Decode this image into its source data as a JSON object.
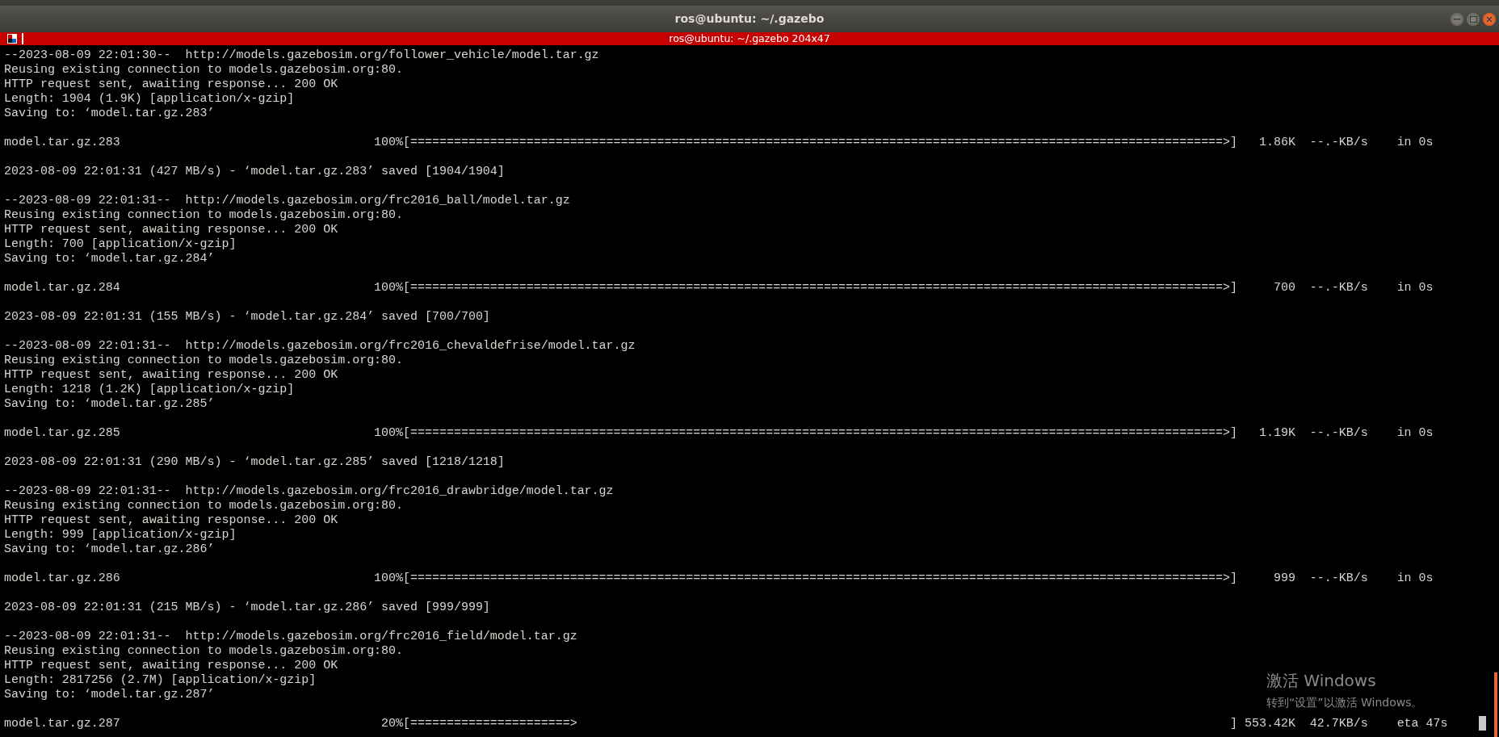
{
  "window": {
    "title": "ros@ubuntu: ~/.gazebo"
  },
  "terminal": {
    "title": "ros@ubuntu: ~/.gazebo 204x47",
    "lines": [
      {
        "kind": "text",
        "text": "--2023-08-09 22:01:30--  http://models.gazebosim.org/follower_vehicle/model.tar.gz"
      },
      {
        "kind": "text",
        "text": "Reusing existing connection to models.gazebosim.org:80."
      },
      {
        "kind": "text",
        "text": "HTTP request sent, awaiting response... 200 OK"
      },
      {
        "kind": "text",
        "text": "Length: 1904 (1.9K) [application/x-gzip]"
      },
      {
        "kind": "text",
        "text": "Saving to: ‘model.tar.gz.283’"
      },
      {
        "kind": "blank"
      },
      {
        "kind": "progress",
        "file": "model.tar.gz.283",
        "percent": "100%",
        "bar": "[================================================================================================================>",
        "bar_end": "]",
        "size": "1.86K",
        "rate": "--.-KB/s",
        "time": "in 0s"
      },
      {
        "kind": "blank"
      },
      {
        "kind": "text",
        "text": "2023-08-09 22:01:31 (427 MB/s) - ‘model.tar.gz.283’ saved [1904/1904]"
      },
      {
        "kind": "blank"
      },
      {
        "kind": "text",
        "text": "--2023-08-09 22:01:31--  http://models.gazebosim.org/frc2016_ball/model.tar.gz"
      },
      {
        "kind": "text",
        "text": "Reusing existing connection to models.gazebosim.org:80."
      },
      {
        "kind": "text",
        "text": "HTTP request sent, awaiting response... 200 OK"
      },
      {
        "kind": "text",
        "text": "Length: 700 [application/x-gzip]"
      },
      {
        "kind": "text",
        "text": "Saving to: ‘model.tar.gz.284’"
      },
      {
        "kind": "blank"
      },
      {
        "kind": "progress",
        "file": "model.tar.gz.284",
        "percent": "100%",
        "bar": "[================================================================================================================>",
        "bar_end": "]",
        "size": "700",
        "rate": "--.-KB/s",
        "time": "in 0s"
      },
      {
        "kind": "blank"
      },
      {
        "kind": "text",
        "text": "2023-08-09 22:01:31 (155 MB/s) - ‘model.tar.gz.284’ saved [700/700]"
      },
      {
        "kind": "blank"
      },
      {
        "kind": "text",
        "text": "--2023-08-09 22:01:31--  http://models.gazebosim.org/frc2016_chevaldefrise/model.tar.gz"
      },
      {
        "kind": "text",
        "text": "Reusing existing connection to models.gazebosim.org:80."
      },
      {
        "kind": "text",
        "text": "HTTP request sent, awaiting response... 200 OK"
      },
      {
        "kind": "text",
        "text": "Length: 1218 (1.2K) [application/x-gzip]"
      },
      {
        "kind": "text",
        "text": "Saving to: ‘model.tar.gz.285’"
      },
      {
        "kind": "blank"
      },
      {
        "kind": "progress",
        "file": "model.tar.gz.285",
        "percent": "100%",
        "bar": "[================================================================================================================>",
        "bar_end": "]",
        "size": "1.19K",
        "rate": "--.-KB/s",
        "time": "in 0s"
      },
      {
        "kind": "blank"
      },
      {
        "kind": "text",
        "text": "2023-08-09 22:01:31 (290 MB/s) - ‘model.tar.gz.285’ saved [1218/1218]"
      },
      {
        "kind": "blank"
      },
      {
        "kind": "text",
        "text": "--2023-08-09 22:01:31--  http://models.gazebosim.org/frc2016_drawbridge/model.tar.gz"
      },
      {
        "kind": "text",
        "text": "Reusing existing connection to models.gazebosim.org:80."
      },
      {
        "kind": "text",
        "text": "HTTP request sent, awaiting response... 200 OK"
      },
      {
        "kind": "text",
        "text": "Length: 999 [application/x-gzip]"
      },
      {
        "kind": "text",
        "text": "Saving to: ‘model.tar.gz.286’"
      },
      {
        "kind": "blank"
      },
      {
        "kind": "progress",
        "file": "model.tar.gz.286",
        "percent": "100%",
        "bar": "[================================================================================================================>",
        "bar_end": "]",
        "size": "999",
        "rate": "--.-KB/s",
        "time": "in 0s"
      },
      {
        "kind": "blank"
      },
      {
        "kind": "text",
        "text": "2023-08-09 22:01:31 (215 MB/s) - ‘model.tar.gz.286’ saved [999/999]"
      },
      {
        "kind": "blank"
      },
      {
        "kind": "text",
        "text": "--2023-08-09 22:01:31--  http://models.gazebosim.org/frc2016_field/model.tar.gz"
      },
      {
        "kind": "text",
        "text": "Reusing existing connection to models.gazebosim.org:80."
      },
      {
        "kind": "text",
        "text": "HTTP request sent, awaiting response... 200 OK"
      },
      {
        "kind": "text",
        "text": "Length: 2817256 (2.7M) [application/x-gzip]"
      },
      {
        "kind": "text",
        "text": "Saving to: ‘model.tar.gz.287’"
      },
      {
        "kind": "blank"
      },
      {
        "kind": "progress",
        "file": "model.tar.gz.287",
        "percent": "20%",
        "bar": "[======================>",
        "bar_end": "]",
        "size": "553.42K",
        "rate": "42.7KB/s",
        "time": "eta 47s"
      }
    ]
  },
  "activation_notice": {
    "title": "激活 Windows",
    "text": "转到“设置”以激活 Windows。"
  }
}
